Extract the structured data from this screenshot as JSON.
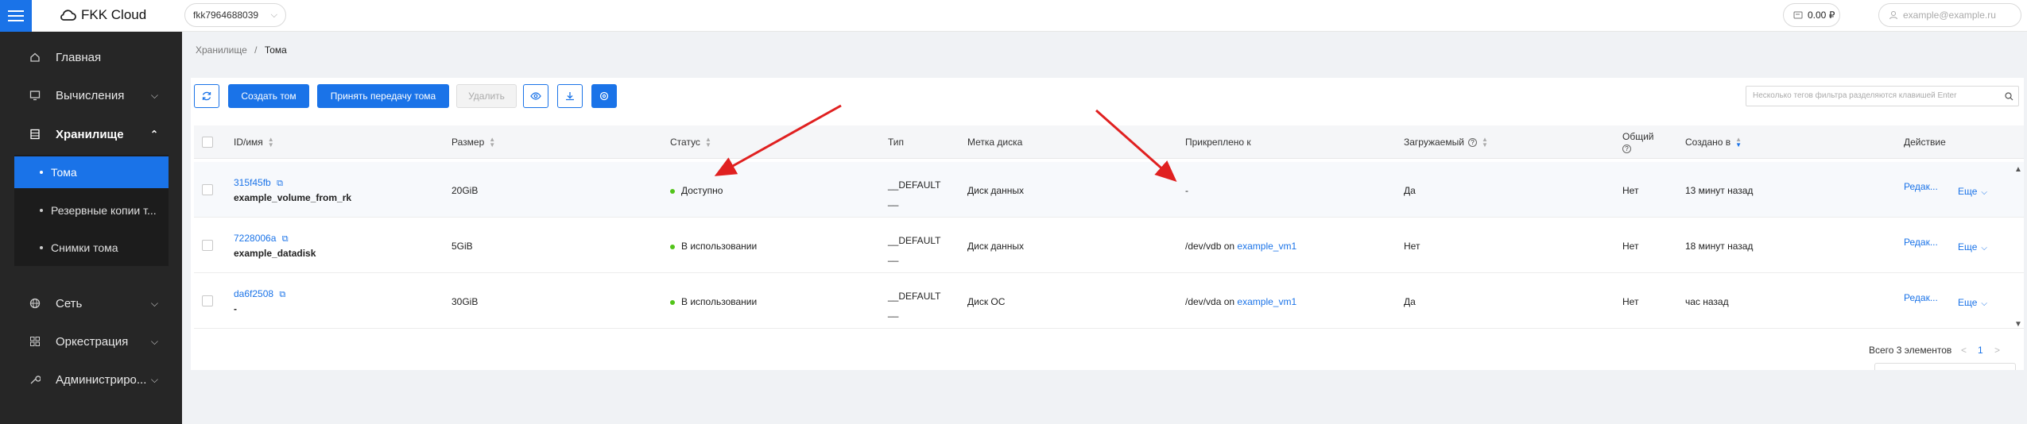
{
  "app": {
    "title": "FKK Cloud"
  },
  "topbar": {
    "project": "fkk7964688039",
    "balance": "0.00 ₽",
    "user_email": "example@example.ru"
  },
  "sidebar": {
    "items": [
      {
        "label": "Главная",
        "icon": "home-icon"
      },
      {
        "label": "Вычисления",
        "icon": "monitor-icon"
      },
      {
        "label": "Хранилище",
        "icon": "storage-icon"
      },
      {
        "label": "Сеть",
        "icon": "globe-icon"
      },
      {
        "label": "Оркестрация",
        "icon": "grid-icon"
      },
      {
        "label": "Администриро...",
        "icon": "wrench-icon"
      }
    ],
    "submenu": [
      {
        "label": "Тома"
      },
      {
        "label": "Резервные копии т..."
      },
      {
        "label": "Снимки тома"
      }
    ]
  },
  "breadcrumb": {
    "parent": "Хранилище",
    "separator": "/",
    "current": "Тома"
  },
  "toolbar": {
    "create": "Создать том",
    "accept_transfer": "Принять передачу тома",
    "delete": "Удалить"
  },
  "filter": {
    "placeholder": "Несколько тегов фильтра разделяются клавишей Enter"
  },
  "table": {
    "columns": [
      "ID/имя",
      "Размер",
      "Статус",
      "Тип",
      "Метка диска",
      "Прикреплено к",
      "Загружаемый",
      "Общий",
      "Создано в",
      "Действие"
    ],
    "rows": [
      {
        "id": "315f45fb",
        "name": "example_volume_from_rk",
        "size": "20GiB",
        "status": "Доступно",
        "type_line1": "__DEFAULT",
        "type_line2": "__",
        "label": "Диск данных",
        "attached_prefix": "-",
        "attached_on": "",
        "attached_vm": "",
        "bootable": "Да",
        "shared": "Нет",
        "created": "13 минут назад",
        "edit": "Редак...",
        "more": "Еще"
      },
      {
        "id": "7228006a",
        "name": "example_datadisk",
        "size": "5GiB",
        "status": "В использовании",
        "type_line1": "__DEFAULT",
        "type_line2": "__",
        "label": "Диск данных",
        "attached_prefix": "/dev/vdb",
        "attached_on": "on",
        "attached_vm": "example_vm1",
        "bootable": "Нет",
        "shared": "Нет",
        "created": "18 минут назад",
        "edit": "Редак...",
        "more": "Еще"
      },
      {
        "id": "da6f2508",
        "name": "-",
        "size": "30GiB",
        "status": "В использовании",
        "type_line1": "__DEFAULT",
        "type_line2": "__",
        "label": "Диск ОС",
        "attached_prefix": "/dev/vda",
        "attached_on": "on",
        "attached_vm": "example_vm1",
        "bootable": "Да",
        "shared": "Нет",
        "created": "час назад",
        "edit": "Редак...",
        "more": "Еще"
      }
    ]
  },
  "pagination": {
    "total": "Всего 3 элементов",
    "page": "1"
  },
  "colors": {
    "accent": "#1a73e8",
    "sidebar_bg": "#262626",
    "status_ok": "#52c41a",
    "annotation_arrow": "#e02020"
  }
}
